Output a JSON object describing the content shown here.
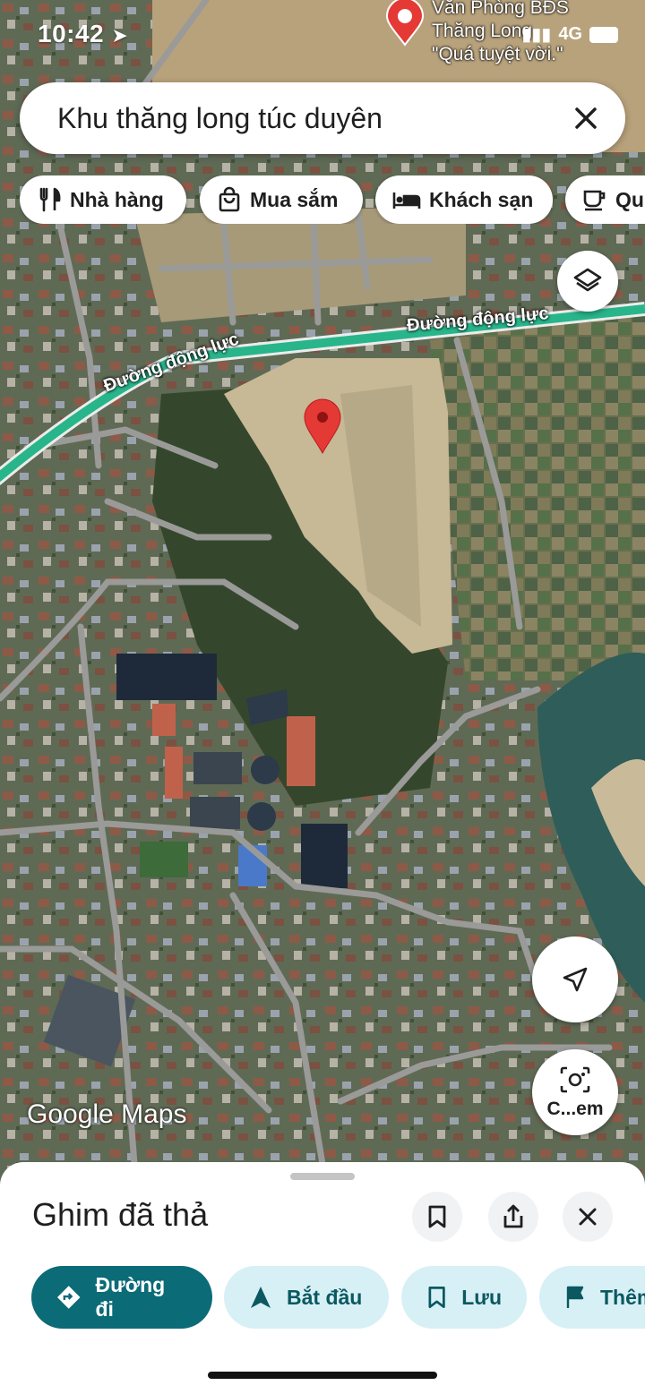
{
  "status": {
    "time": "10:42",
    "network": "4G"
  },
  "search": {
    "query": "Khu thăng long túc duyên"
  },
  "chips": [
    {
      "label": "Nhà hàng",
      "icon": "fork-knife-icon"
    },
    {
      "label": "Mua sắm",
      "icon": "shopping-bag-icon"
    },
    {
      "label": "Khách sạn",
      "icon": "bed-icon"
    },
    {
      "label": "Qu",
      "icon": "coffee-cup-icon"
    }
  ],
  "map": {
    "poi": {
      "line1": "Văn Phòng BĐS",
      "line2": "Thăng Long",
      "line3": "\"Quá tuyệt vời.\""
    },
    "roads": {
      "road1": "Đường động lực",
      "road2": "Đường động lực"
    },
    "watermark_google": "Google",
    "watermark_maps": "Maps",
    "camera_label": "C...em"
  },
  "sheet": {
    "title": "Ghim đã thả",
    "actions": [
      {
        "label": "Đường đi",
        "icon": "directions-icon"
      },
      {
        "label": "Bắt đầu",
        "icon": "navigation-arrow-icon"
      },
      {
        "label": "Lưu",
        "icon": "bookmark-icon"
      },
      {
        "label": "Thêm",
        "icon": "flag-icon"
      }
    ]
  },
  "colors": {
    "accent": "#0b6b77",
    "pin": "#e53935",
    "chip_bg": "#d7f0f6"
  }
}
